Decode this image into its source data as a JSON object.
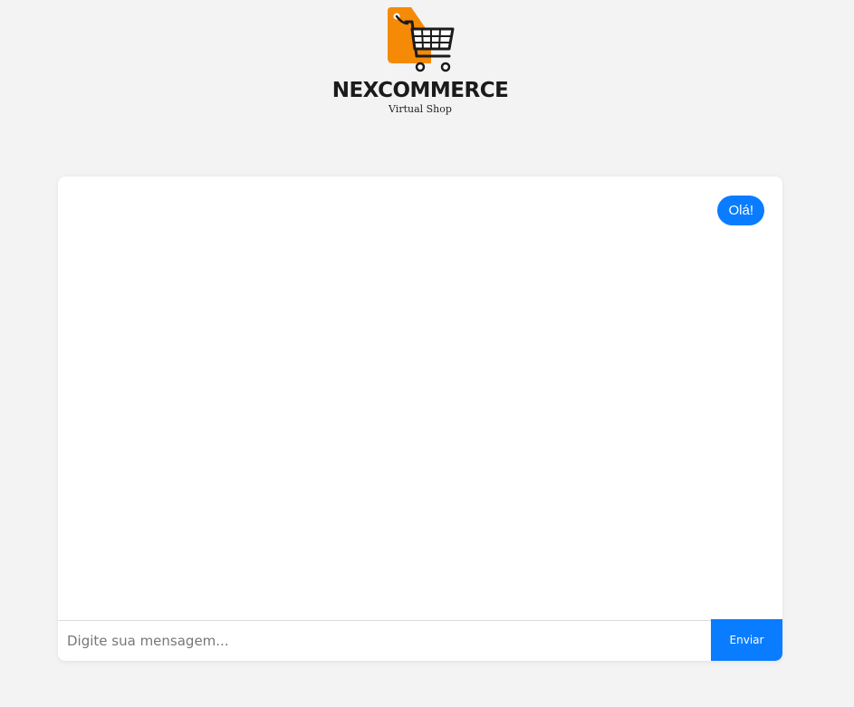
{
  "brand": {
    "name": "NEXCOMMERCE",
    "tagline": "Virtual Shop",
    "logo_icon": "shopping-cart-tag-icon",
    "colors": {
      "tag": "#f58a07",
      "ink": "#1b1b1b"
    }
  },
  "chat": {
    "messages": [
      {
        "sender": "user",
        "text": "Olá!"
      }
    ],
    "input": {
      "value": "",
      "placeholder": "Digite sua mensagem..."
    },
    "send_label": "Enviar",
    "accent_color": "#0a7cff"
  }
}
